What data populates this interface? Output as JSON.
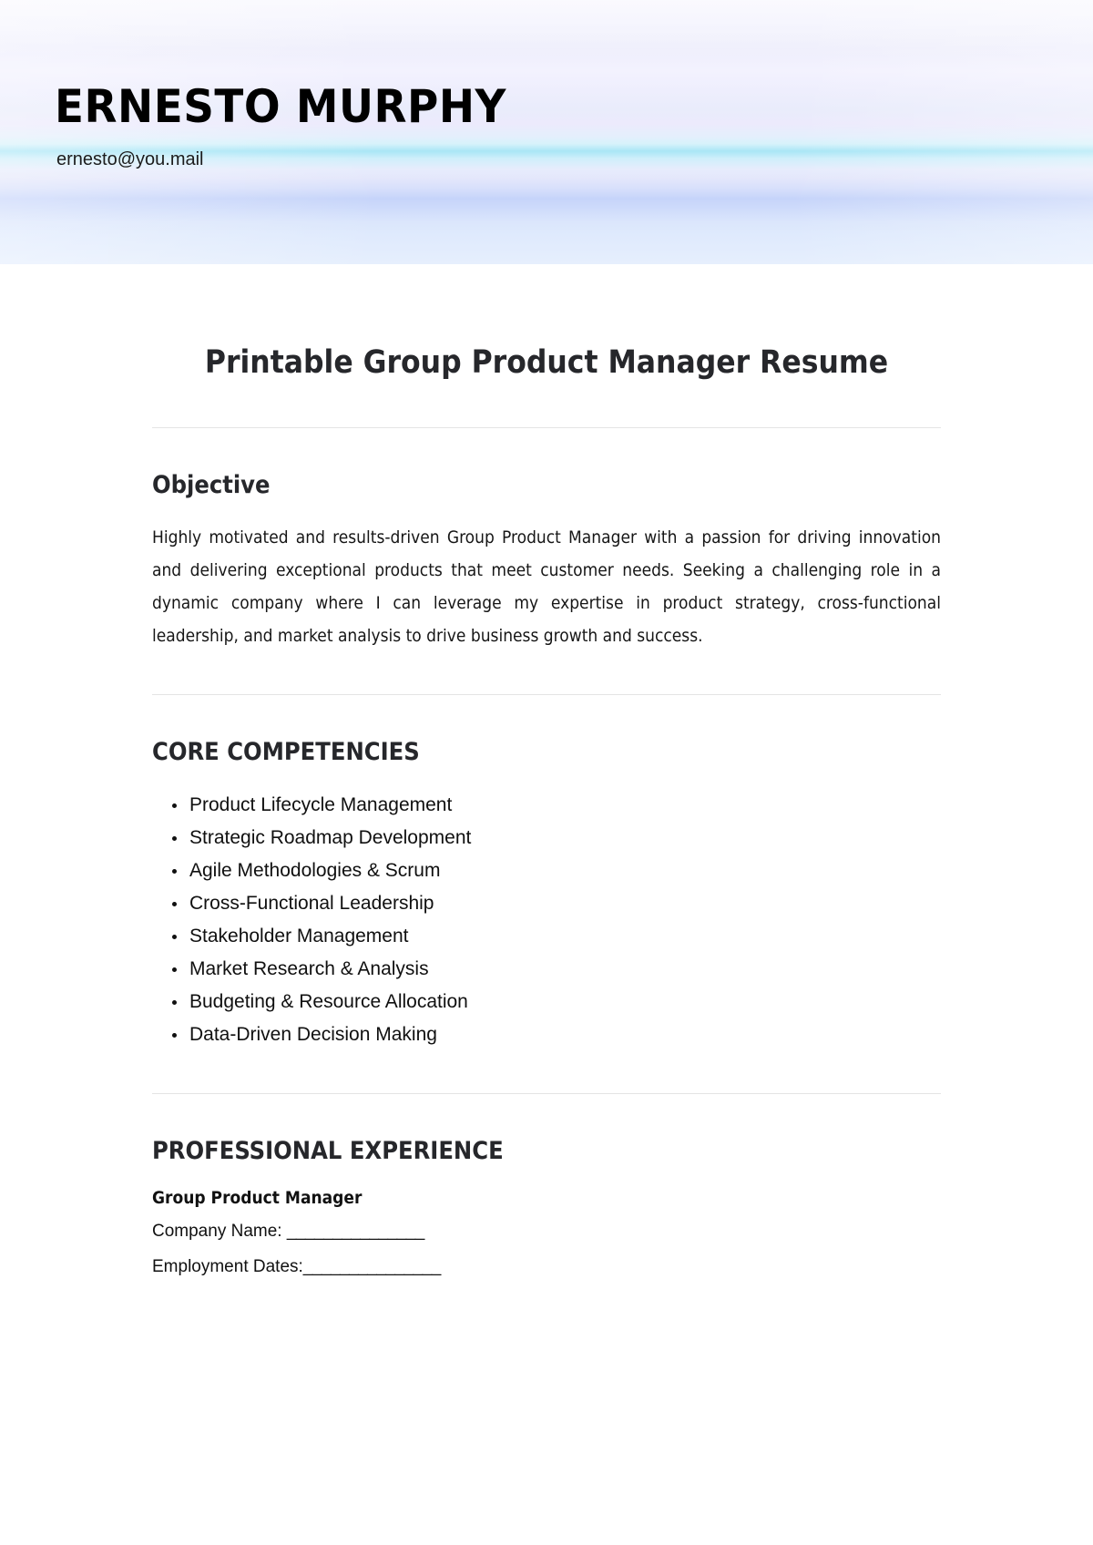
{
  "header": {
    "name": "ERNESTO MURPHY",
    "email": "ernesto@you.mail",
    "colors": {
      "top": "#f4f3fe",
      "cyan_streak": "#a9e6f6",
      "periwinkle": "#c6d4fa",
      "bottom": "#e6effd"
    }
  },
  "document": {
    "title": "Printable Group Product Manager Resume",
    "sections": {
      "objective": {
        "heading": "Objective",
        "paragraph": "Highly motivated and results-driven Group Product Manager with a passion for driving innovation and delivering exceptional products that meet customer needs. Seeking a challenging role in a dynamic company where I can leverage my expertise in product strategy, cross-functional leadership, and market analysis to drive business growth and success."
      },
      "core_competencies": {
        "heading": "CORE COMPETENCIES",
        "items": [
          "Product Lifecycle Management",
          "Strategic Roadmap Development",
          "Agile Methodologies & Scrum",
          "Cross-Functional Leadership",
          "Stakeholder Management",
          "Market Research & Analysis",
          "Budgeting & Resource Allocation",
          "Data-Driven Decision Making"
        ]
      },
      "professional_experience": {
        "heading": "PROFESSIONAL EXPERIENCE",
        "entries": [
          {
            "job_title": "Group Product Manager",
            "company_label": "Company Name: ",
            "company_value": "_______________",
            "dates_label": "Employment Dates:",
            "dates_value": "_______________"
          }
        ]
      }
    }
  }
}
